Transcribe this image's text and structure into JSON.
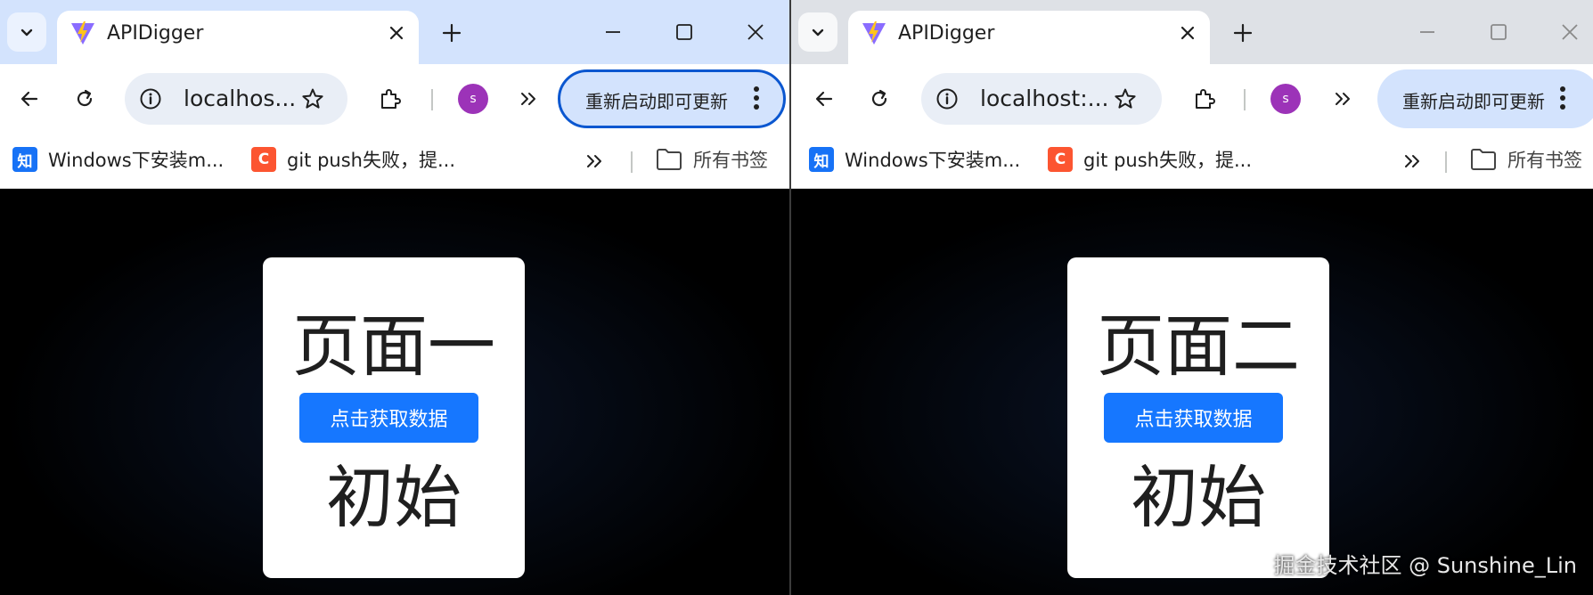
{
  "left_window": {
    "tab_title": "APIDigger",
    "address_text": "localhos...",
    "avatar_letter": "s",
    "update_label": "重新启动即可更新",
    "bookmarks": [
      {
        "icon_text": "知",
        "label": "Windows下安装m..."
      },
      {
        "icon_text": "C",
        "label": "git push失败，提..."
      }
    ],
    "all_bookmarks_label": "所有书签",
    "page_title": "页面一",
    "button_label": "点击获取数据",
    "status_text": "初始"
  },
  "right_window": {
    "tab_title": "APIDigger",
    "address_text": "localhost:...",
    "avatar_letter": "s",
    "update_label": "重新启动即可更新",
    "bookmarks": [
      {
        "icon_text": "知",
        "label": "Windows下安装m..."
      },
      {
        "icon_text": "C",
        "label": "git push失败，提..."
      }
    ],
    "all_bookmarks_label": "所有书签",
    "page_title": "页面二",
    "button_label": "点击获取数据",
    "status_text": "初始"
  },
  "watermark": "掘金技术社区 @ Sunshine_Lin",
  "colors": {
    "active_tabstrip": "#d3e3fd",
    "inactive_tabstrip": "#dee1e6",
    "primary_button": "#1677ff",
    "avatar": "#9c33b8",
    "focus_ring": "#0b57d0"
  },
  "icons": [
    "tab-search-icon",
    "vite-logo-icon",
    "close-icon",
    "plus-icon",
    "minimize-icon",
    "maximize-icon",
    "back-arrow-icon",
    "reload-icon",
    "info-icon",
    "star-icon",
    "extensions-icon",
    "chevrons-right-icon",
    "more-vert-icon",
    "folder-icon"
  ]
}
